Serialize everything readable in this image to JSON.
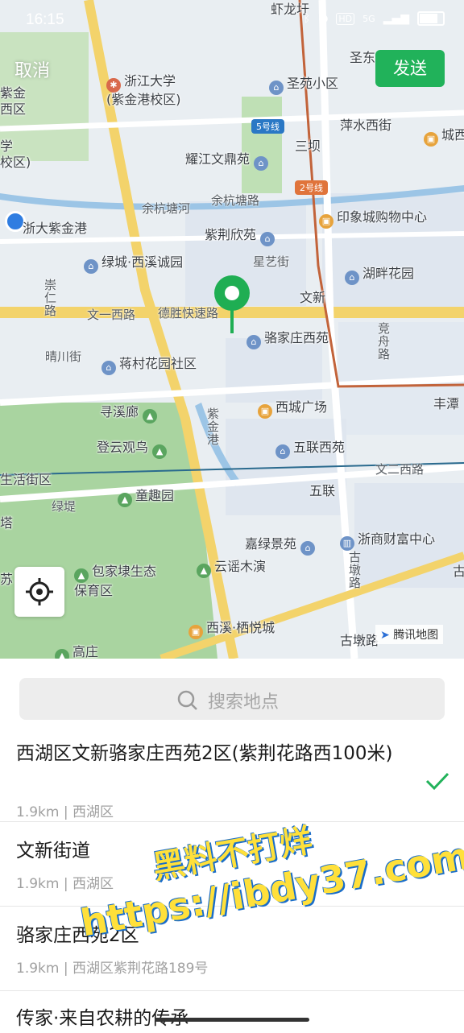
{
  "status_bar": {
    "time": "16:15",
    "icons": [
      "bluetooth-icon",
      "location-icon",
      "hd-icon",
      "signal-icon",
      "battery-icon"
    ],
    "network_label": "5G",
    "hd_label": "HD"
  },
  "header": {
    "cancel_label": "取消",
    "send_label": "发送"
  },
  "map": {
    "pois": [
      {
        "label": "虾龙圩",
        "icon": "none"
      },
      {
        "label": "浙江大学\n(紫金港校区)",
        "icon": "school-icon"
      },
      {
        "label": "紫金\n西区",
        "icon": "school-icon"
      },
      {
        "label": "圣苑小区",
        "icon": "residential-icon"
      },
      {
        "label": "圣东街",
        "icon": "none"
      },
      {
        "label": "萍水西街",
        "icon": "none"
      },
      {
        "label": "城西",
        "icon": "shopping-icon"
      },
      {
        "label": "三坝",
        "icon": "metro-icon"
      },
      {
        "label": "耀江文鼎苑",
        "icon": "residential-icon"
      },
      {
        "label": "学\n校区)",
        "icon": "none"
      },
      {
        "label": "余杭塘河",
        "icon": "none"
      },
      {
        "label": "余杭塘路",
        "icon": "none"
      },
      {
        "label": "印象城购物中心",
        "icon": "shopping-icon"
      },
      {
        "label": "浙大紫金港",
        "icon": "none"
      },
      {
        "label": "紫荆欣苑",
        "icon": "residential-icon"
      },
      {
        "label": "绿城·西溪诚园",
        "icon": "residential-icon"
      },
      {
        "label": "星艺街",
        "icon": "none"
      },
      {
        "label": "湖畔花园",
        "icon": "residential-icon"
      },
      {
        "label": "崇仁路",
        "icon": "none"
      },
      {
        "label": "文新",
        "icon": "metro-icon"
      },
      {
        "label": "文一西路",
        "icon": "none"
      },
      {
        "label": "德胜快速路",
        "icon": "none"
      },
      {
        "label": "骆家庄西苑",
        "icon": "residential-icon"
      },
      {
        "label": "竞舟路",
        "icon": "none"
      },
      {
        "label": "晴川街",
        "icon": "none"
      },
      {
        "label": "蒋村花园社区",
        "icon": "residential-icon"
      },
      {
        "label": "丰潭",
        "icon": "none"
      },
      {
        "label": "寻溪廊",
        "icon": "park-icon"
      },
      {
        "label": "西城广场",
        "icon": "shopping-icon"
      },
      {
        "label": "紫金港",
        "icon": "none"
      },
      {
        "label": "登云观鸟",
        "icon": "park-icon"
      },
      {
        "label": "五联西苑",
        "icon": "residential-icon"
      },
      {
        "label": "生活街区",
        "icon": "none"
      },
      {
        "label": "文二西路",
        "icon": "none"
      },
      {
        "label": "童趣园",
        "icon": "park-icon"
      },
      {
        "label": "五联",
        "icon": "metro-icon"
      },
      {
        "label": "绿堤",
        "icon": "none"
      },
      {
        "label": "塔",
        "icon": "none"
      },
      {
        "label": "嘉绿景苑",
        "icon": "residential-icon"
      },
      {
        "label": "浙商财富中心",
        "icon": "office-icon"
      },
      {
        "label": "包家埭生态\n保育区",
        "icon": "park-icon"
      },
      {
        "label": "云谣木演",
        "icon": "park-icon"
      },
      {
        "label": "古墩路",
        "icon": "none"
      },
      {
        "label": "西溪·栖悦城",
        "icon": "shopping-icon"
      },
      {
        "label": "高庄",
        "icon": "park-icon"
      },
      {
        "label": "古墩路",
        "icon": "metro-icon"
      },
      {
        "label": "苏",
        "icon": "none"
      },
      {
        "label": "古",
        "icon": "none"
      }
    ],
    "line_badges": [
      "5号线",
      "2号线"
    ],
    "attribution": "腾讯地图",
    "locate_button": "crosshair-icon",
    "pin": "map-pin-icon",
    "colors": {
      "pin": "#1fae53",
      "send": "#21b25a",
      "metro_line": "#c2633a"
    }
  },
  "search": {
    "placeholder": "搜索地点",
    "icon": "search-icon"
  },
  "results": [
    {
      "title": "西湖区文新骆家庄西苑2区(紫荆花路西100米)",
      "subtitle": "1.9km | 西湖区",
      "selected": true
    },
    {
      "title": "文新街道",
      "subtitle": "1.9km | 西湖区",
      "selected": false
    },
    {
      "title": "骆家庄西苑2区",
      "subtitle": "1.9km | 西湖区紫荆花路189号",
      "selected": false
    },
    {
      "title": "传家·来自农耕的传承",
      "subtitle": "",
      "selected": false
    }
  ],
  "watermark": {
    "line1": "黑料不打烊",
    "line2": "https://ibdy37.com"
  }
}
